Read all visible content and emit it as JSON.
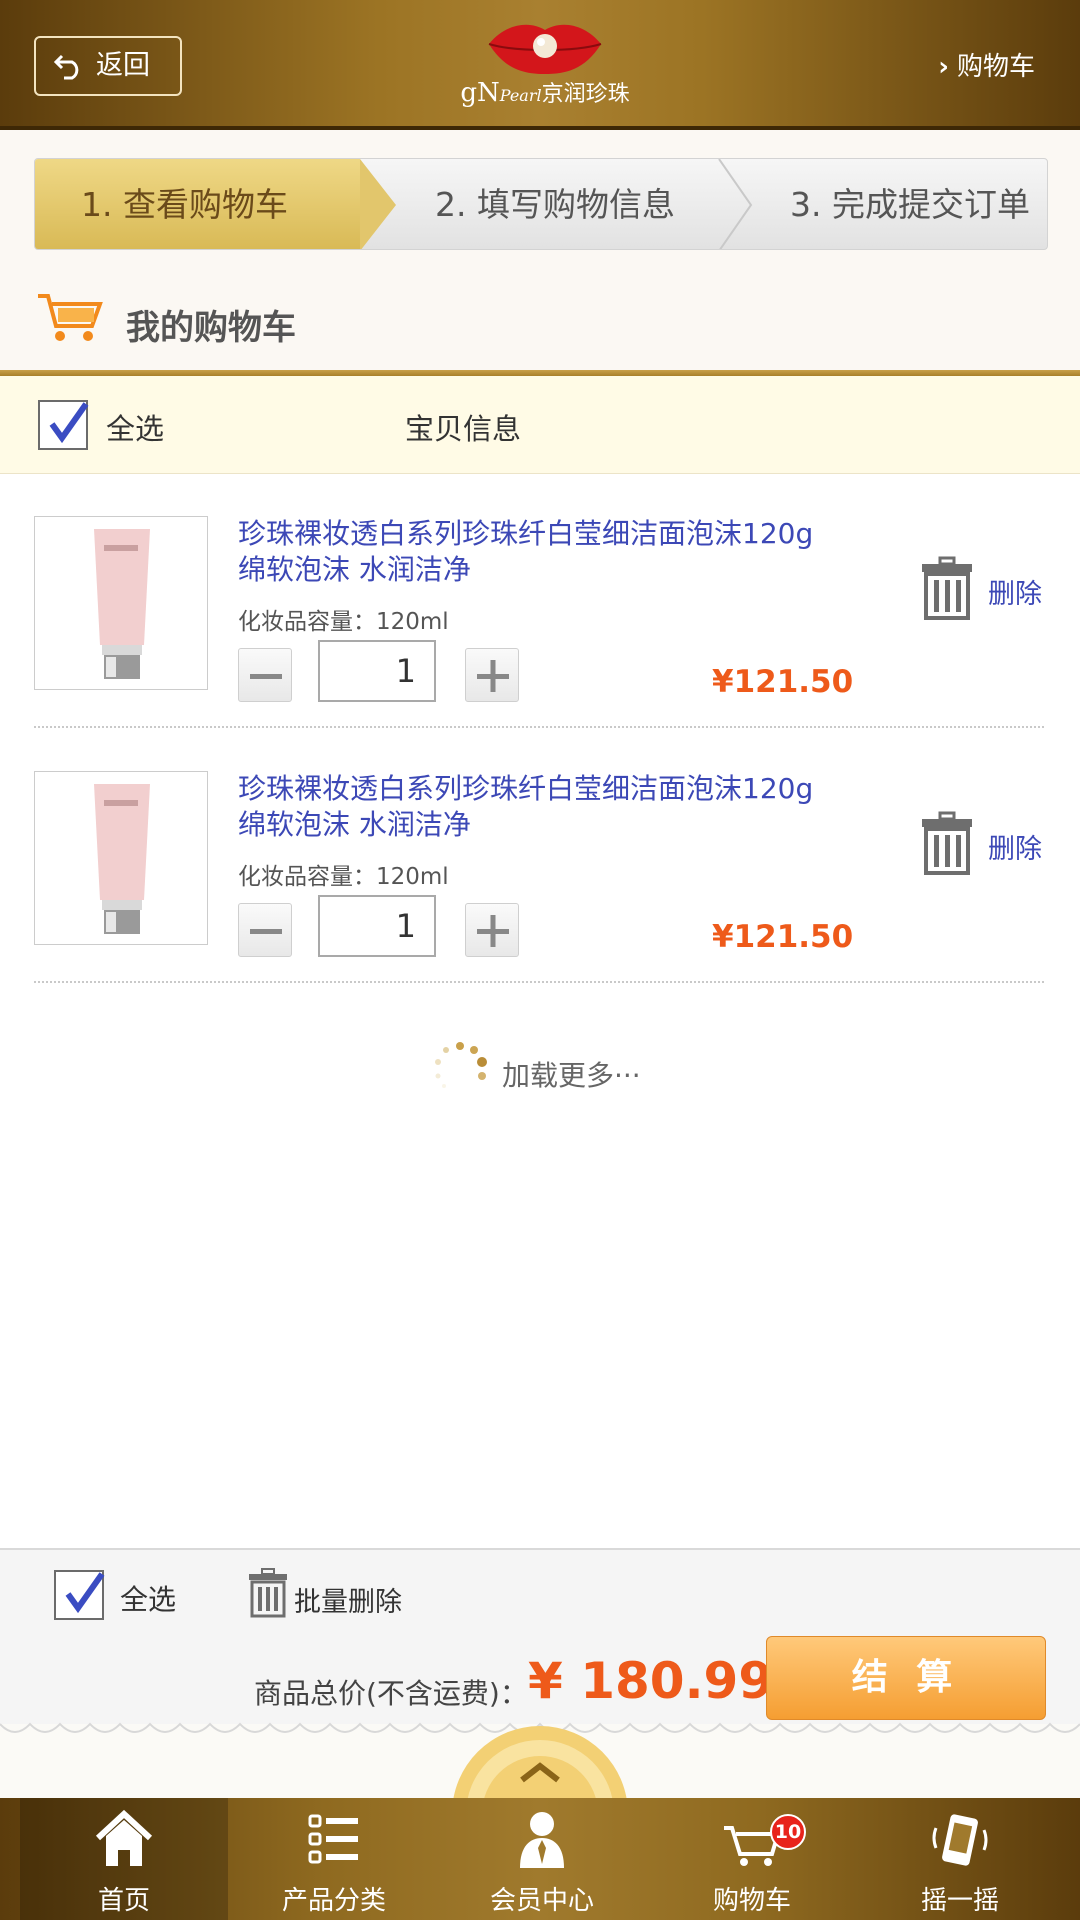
{
  "colors": {
    "brand_gold": "#a98030",
    "brand_brown": "#5b3c0c",
    "link_blue": "#3c48b6",
    "price_orange": "#ee5a1a",
    "checkout": "#f59e32"
  },
  "header": {
    "back_label": "返回",
    "logo_text_latin": "gN",
    "logo_text_script": "Pearl",
    "logo_text_cn": "京润珍珠",
    "cart_link_label": "购物车"
  },
  "steps": [
    {
      "label": "1. 查看购物车",
      "active": true
    },
    {
      "label": "2. 填写购物信息",
      "active": false
    },
    {
      "label": "3. 完成提交订单",
      "active": false
    }
  ],
  "section_title": "我的购物车",
  "list_header": {
    "select_all": "全选",
    "info": "宝贝信息",
    "select_all_checked": true
  },
  "items": [
    {
      "title_line1": "珍珠裸妆透白系列珍珠纤白莹细洁面泡沫120g",
      "title_line2": "绵软泡沫  水润洁净",
      "spec": "化妆品容量：120ml",
      "quantity": "1",
      "price": "¥121.50",
      "delete_label": "删除"
    },
    {
      "title_line1": "珍珠裸妆透白系列珍珠纤白莹细洁面泡沫120g",
      "title_line2": "绵软泡沫  水润洁净",
      "spec": "化妆品容量：120ml",
      "quantity": "1",
      "price": "¥121.50",
      "delete_label": "删除"
    }
  ],
  "load_more": "加载更多···",
  "footer": {
    "select_all": "全选",
    "batch_delete": "批量删除",
    "total_label": "商品总价(不含运费)：",
    "total_value": "¥ 180.99",
    "checkout": "结 算"
  },
  "tabbar": [
    {
      "label": "首页",
      "icon": "home-icon",
      "active": true
    },
    {
      "label": "产品分类",
      "icon": "list-icon",
      "active": false
    },
    {
      "label": "会员中心",
      "icon": "user-icon",
      "active": false
    },
    {
      "label": "购物车",
      "icon": "cart-icon",
      "active": false,
      "badge": "10"
    },
    {
      "label": "摇一摇",
      "icon": "shake-phone-icon",
      "active": false
    }
  ]
}
